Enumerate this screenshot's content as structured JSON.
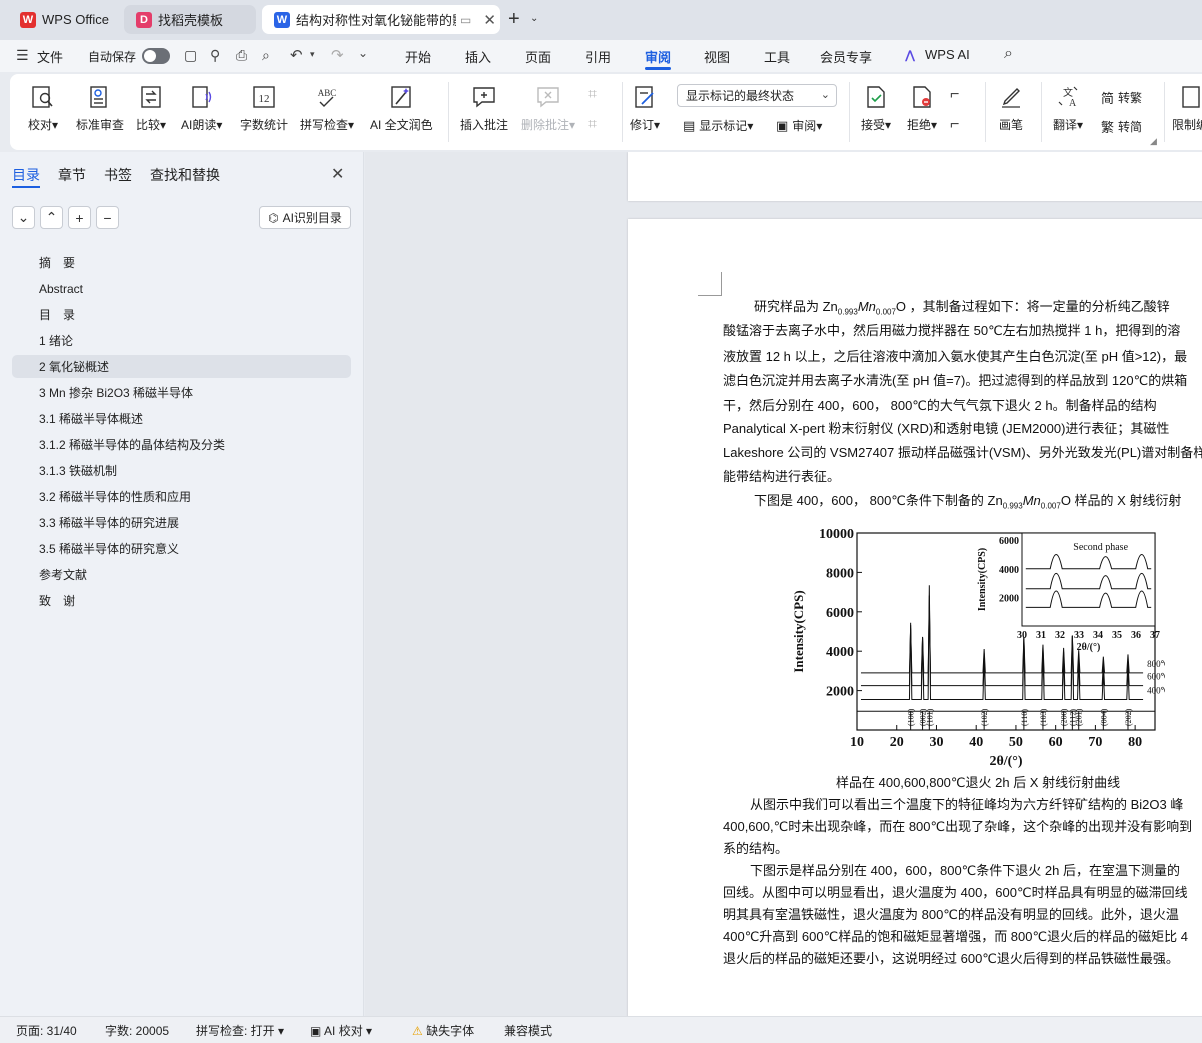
{
  "tabs": [
    {
      "label": "WPS Office",
      "icon": "wps-logo-icon"
    },
    {
      "label": "找稻壳模板",
      "icon": "docer-icon"
    },
    {
      "label": "结构对称性对氧化铋能带的影",
      "icon": "word-doc-icon"
    }
  ],
  "menu": {
    "file": "文件",
    "autosave": "自动保存",
    "items": [
      "开始",
      "插入",
      "页面",
      "引用",
      "审阅",
      "视图",
      "工具",
      "会员专享",
      "WPS AI"
    ],
    "active": "审阅"
  },
  "ribbon": {
    "proofread": "校对",
    "standard_review": "标准审查",
    "compare": "比较",
    "ai_read": "AI朗读",
    "word_count": "字数统计",
    "spell_check": "拼写检查",
    "ai_polish": "AI 全文润色",
    "insert_comment": "插入批注",
    "delete_comment": "删除批注",
    "revise": "修订",
    "markup_display_select": "显示标记的最终状态",
    "show_markup": "显示标记",
    "review": "审阅",
    "accept": "接受",
    "reject": "拒绝",
    "pen": "画笔",
    "translate": "翻译",
    "to_traditional": "转繁",
    "to_simplified": "转简",
    "restrict": "限制编",
    "word_count_icon_text": "12",
    "spell_icon_text": "ABC"
  },
  "leftpane": {
    "tabs": [
      "目录",
      "章节",
      "书签",
      "查找和替换"
    ],
    "active_tab": "目录",
    "ai_toc": "AI识别目录",
    "toc": [
      {
        "label": "摘　要",
        "indent": 0,
        "active": false
      },
      {
        "label": "Abstract",
        "indent": 0,
        "active": false
      },
      {
        "label": "目　录",
        "indent": 0,
        "active": false
      },
      {
        "label": "1 绪论",
        "indent": 0,
        "active": false
      },
      {
        "label": "2 氧化铋概述",
        "indent": 0,
        "active": true
      },
      {
        "label": "3 Mn 掺杂 Bi2O3 稀磁半导体",
        "indent": 0,
        "active": false
      },
      {
        "label": "3.1  稀磁半导体概述",
        "indent": 0,
        "active": false
      },
      {
        "label": "3.1.2 稀磁半导体的晶体结构及分类",
        "indent": 0,
        "active": false
      },
      {
        "label": "3.1.3 铁磁机制",
        "indent": 0,
        "active": false
      },
      {
        "label": "3.2 稀磁半导体的性质和应用",
        "indent": 0,
        "active": false
      },
      {
        "label": "3.3 稀磁半导体的研究进展",
        "indent": 0,
        "active": false
      },
      {
        "label": "3.5 稀磁半导体的研究意义",
        "indent": 0,
        "active": false
      },
      {
        "label": "参考文献",
        "indent": 0,
        "active": false
      },
      {
        "label": "致　谢",
        "indent": 0,
        "active": false
      }
    ]
  },
  "document": {
    "p1": {
      "pre": "研究样品为 Zn",
      "sub1": "0.993",
      "mid": "Mn",
      "sub2": "0.007",
      "post": "O  ，其制备过程如下：将一定量的分析纯乙酸锌"
    },
    "lines": [
      "酸锰溶于去离子水中，然后用磁力搅拌器在 50℃左右加热搅拌 1 h，把得到的溶",
      "液放置 12 h 以上，之后往溶液中滴加入氨水使其产生白色沉淀(至 pH 值>12)，最",
      "滤白色沉淀并用去离子水清洗(至 pH 值=7)。把过滤得到的样品放到 120℃的烘箱",
      "干，然后分别在 400，600，  800℃的大气气氛下退火 2 h。制备样品的结构",
      "Panalytical X-pert 粉末衍射仪 (XRD)和透射电镜 (JEM2000)进行表征；其磁性",
      "Lakeshore 公司的 VSM27407 振动样品磁强计(VSM)、另外光致发光(PL)谱对制备样",
      "能带结构进行表征。"
    ],
    "p2": {
      "pre": "下图是 400，600，  800℃条件下制备的 Zn",
      "sub1": "0.993",
      "mid": "Mn",
      "sub2": "0.007",
      "post": "O 样品的 X 射线衍射"
    },
    "caption": "样品在 400,600,800℃退火 2h 后 X 射线衍射曲线",
    "p3": [
      "从图示中我们可以看出三个温度下的特征峰均为六方纤锌矿结构的 Bi2O3 峰",
      "400,600,℃时未出现杂峰，而在 800℃出现了杂峰，这个杂峰的出现并没有影响到",
      "系的结构。"
    ],
    "p4": [
      "下图示是样品分别在 400，600，800℃条件下退火 2h 后，在室温下测量的",
      "回线。从图中可以明显看出，退火温度为 400，600℃时样品具有明显的磁滞回线",
      "明其具有室温铁磁性，退火温度为 800℃的样品没有明显的回线。此外，退火温",
      "400℃升高到 600℃样品的饱和磁矩显著增强，而 800℃退火后的样品的磁矩比 4",
      "退火后的样品的磁矩还要小，这说明经过 600℃退火后得到的样品铁磁性最强。"
    ]
  },
  "chart_data": {
    "type": "line",
    "title": "",
    "xlabel": "2θ/(°)",
    "ylabel": "Intensity(CPS)",
    "xlim": [
      10,
      85
    ],
    "ylim": [
      0,
      10000
    ],
    "xticks": [
      10,
      20,
      30,
      40,
      50,
      60,
      70,
      80
    ],
    "yticks": [
      2000,
      4000,
      6000,
      8000,
      10000
    ],
    "series": [
      {
        "name": "800℃",
        "baseline": 2900
      },
      {
        "name": "600℃",
        "baseline": 2250
      },
      {
        "name": "400℃",
        "baseline": 1550
      }
    ],
    "peaks": [
      {
        "x": 23.5,
        "y": 5600,
        "hkl": "(100)"
      },
      {
        "x": 26.5,
        "y": 4800,
        "hkl": "(002)"
      },
      {
        "x": 28.2,
        "y": 7600,
        "hkl": "(101)"
      },
      {
        "x": 42.0,
        "y": 3700,
        "hkl": "(102)"
      },
      {
        "x": 52.0,
        "y": 4800,
        "hkl": "(110)"
      },
      {
        "x": 56.8,
        "y": 4100,
        "hkl": "(103)"
      },
      {
        "x": 62.0,
        "y": 3800,
        "hkl": "(200)"
      },
      {
        "x": 64.2,
        "y": 4900,
        "hkl": "(112)"
      },
      {
        "x": 65.8,
        "y": 3600,
        "hkl": "(201)"
      },
      {
        "x": 72.0,
        "y": 3000,
        "hkl": "(004)"
      },
      {
        "x": 78.2,
        "y": 3200,
        "hkl": "(202)"
      }
    ],
    "inset": {
      "xlim": [
        30,
        37
      ],
      "ylim": [
        0,
        6500
      ],
      "xticks": [
        30,
        31,
        32,
        33,
        34,
        35,
        36,
        37
      ],
      "yticks": [
        2000,
        4000,
        6000
      ],
      "ylabel": "Intensity(CPS)",
      "xlabel": "2θ/(°)",
      "annotation": "Second phase",
      "peaks": [
        31.8,
        34.4,
        36.3
      ],
      "baselines": [
        1300,
        2600,
        4000
      ]
    }
  },
  "status": {
    "page": "页面: 31/40",
    "words": "字数: 20005",
    "spell": "拼写检查: 打开",
    "ai_check": "AI 校对",
    "missing_font": "缺失字体",
    "compat": "兼容模式"
  }
}
